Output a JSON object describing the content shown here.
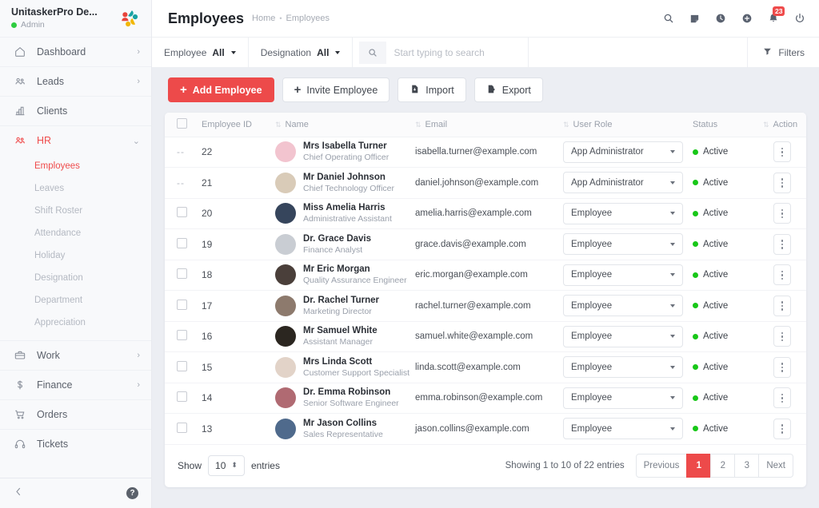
{
  "sidebar": {
    "brand_name": "UnitaskerPro De...",
    "brand_role": "Admin",
    "logo_icon": "unitasker-logo",
    "items": [
      {
        "label": "Dashboard",
        "icon": "home-icon",
        "chevron": "›",
        "active": false
      },
      {
        "label": "Leads",
        "icon": "users-icon",
        "chevron": "›",
        "active": false
      },
      {
        "label": "Clients",
        "icon": "chart-building-icon",
        "chevron": "",
        "active": false
      },
      {
        "label": "HR",
        "icon": "people-group-icon",
        "chevron": "⌄",
        "active": true
      }
    ],
    "hr_subitems": [
      {
        "label": "Employees",
        "active": true
      },
      {
        "label": "Leaves",
        "active": false
      },
      {
        "label": "Shift Roster",
        "active": false
      },
      {
        "label": "Attendance",
        "active": false
      },
      {
        "label": "Holiday",
        "active": false
      },
      {
        "label": "Designation",
        "active": false
      },
      {
        "label": "Department",
        "active": false
      },
      {
        "label": "Appreciation",
        "active": false
      }
    ],
    "items_bottom": [
      {
        "label": "Work",
        "icon": "briefcase-icon",
        "chevron": "›"
      },
      {
        "label": "Finance",
        "icon": "dollar-icon",
        "chevron": "›"
      },
      {
        "label": "Orders",
        "icon": "cart-icon",
        "chevron": ""
      },
      {
        "label": "Tickets",
        "icon": "headset-icon",
        "chevron": ""
      }
    ],
    "collapse_icon": "chevron-left-icon",
    "help_label": "?"
  },
  "header": {
    "title": "Employees",
    "breadcrumb": [
      "Home",
      "Employees"
    ],
    "separator": "•",
    "icons": [
      {
        "name": "search-icon"
      },
      {
        "name": "note-icon"
      },
      {
        "name": "clock-icon"
      },
      {
        "name": "plus-circle-icon"
      },
      {
        "name": "bell-icon",
        "badge": "23"
      },
      {
        "name": "power-icon"
      }
    ]
  },
  "filterbar": {
    "employee_label": "Employee",
    "employee_value": "All",
    "designation_label": "Designation",
    "designation_value": "All",
    "search_placeholder": "Start typing to search",
    "search_value": "",
    "filters_label": "Filters"
  },
  "toolbar": {
    "add_label": "Add Employee",
    "invite_label": "Invite Employee",
    "import_label": "Import",
    "export_label": "Export"
  },
  "table": {
    "columns": [
      "Employee ID",
      "Name",
      "Email",
      "User Role",
      "Status",
      "Action"
    ],
    "rows": [
      {
        "select": "--",
        "id": "22",
        "name": "Mrs Isabella Turner",
        "designation": "Chief Operating Officer",
        "email": "isabella.turner@example.com",
        "role": "App Administrator",
        "status": "Active",
        "avatar": "#f2c4cf"
      },
      {
        "select": "--",
        "id": "21",
        "name": "Mr Daniel Johnson",
        "designation": "Chief Technology Officer",
        "email": "daniel.johnson@example.com",
        "role": "App Administrator",
        "status": "Active",
        "avatar": "#d9cbb8"
      },
      {
        "select": "checkbox",
        "id": "20",
        "name": "Miss Amelia Harris",
        "designation": "Administrative Assistant",
        "email": "amelia.harris@example.com",
        "role": "Employee",
        "status": "Active",
        "avatar": "#36455c"
      },
      {
        "select": "checkbox",
        "id": "19",
        "name": "Dr. Grace Davis",
        "designation": "Finance Analyst",
        "email": "grace.davis@example.com",
        "role": "Employee",
        "status": "Active",
        "avatar": "#c9cdd3"
      },
      {
        "select": "checkbox",
        "id": "18",
        "name": "Mr Eric Morgan",
        "designation": "Quality Assurance Engineer",
        "email": "eric.morgan@example.com",
        "role": "Employee",
        "status": "Active",
        "avatar": "#4a3f3a"
      },
      {
        "select": "checkbox",
        "id": "17",
        "name": "Dr. Rachel Turner",
        "designation": "Marketing Director",
        "email": "rachel.turner@example.com",
        "role": "Employee",
        "status": "Active",
        "avatar": "#8d7a6d"
      },
      {
        "select": "checkbox",
        "id": "16",
        "name": "Mr Samuel White",
        "designation": "Assistant Manager",
        "email": "samuel.white@example.com",
        "role": "Employee",
        "status": "Active",
        "avatar": "#2b2620"
      },
      {
        "select": "checkbox",
        "id": "15",
        "name": "Mrs Linda Scott",
        "designation": "Customer Support Specialist",
        "email": "linda.scott@example.com",
        "role": "Employee",
        "status": "Active",
        "avatar": "#e2d3c8"
      },
      {
        "select": "checkbox",
        "id": "14",
        "name": "Dr. Emma Robinson",
        "designation": "Senior Software Engineer",
        "email": "emma.robinson@example.com",
        "role": "Employee",
        "status": "Active",
        "avatar": "#b06a72"
      },
      {
        "select": "checkbox",
        "id": "13",
        "name": "Mr Jason Collins",
        "designation": "Sales Representative",
        "email": "jason.collins@example.com",
        "role": "Employee",
        "status": "Active",
        "avatar": "#4f6a8c"
      }
    ]
  },
  "footer": {
    "show_label": "Show",
    "show_value": "10",
    "entries_label": "entries",
    "showing_text": "Showing 1 to 10 of 22 entries",
    "pages": [
      {
        "label": "Previous",
        "active": false
      },
      {
        "label": "1",
        "active": true
      },
      {
        "label": "2",
        "active": false
      },
      {
        "label": "3",
        "active": false
      },
      {
        "label": "Next",
        "active": false
      }
    ]
  },
  "colors": {
    "accent": "#ed4a4a",
    "status_active": "#18c718",
    "online": "#2ecc40"
  }
}
